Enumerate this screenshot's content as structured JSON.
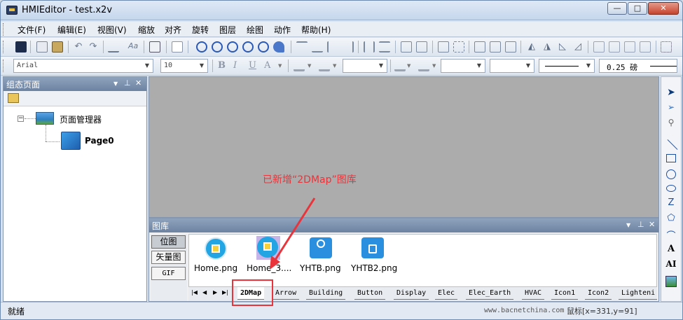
{
  "window": {
    "title": "HMIEditor - test.x2v"
  },
  "window_controls": {
    "minimize": "—",
    "maximize": "□",
    "close": "✕"
  },
  "menu": [
    "文件(F)",
    "编辑(E)",
    "视图(V)",
    "缩放",
    "对齐",
    "旋转",
    "图层",
    "绘图",
    "动作",
    "帮助(H)"
  ],
  "format_bar": {
    "font": "Arial",
    "size": "10",
    "line_width": "0.25 磅"
  },
  "left_panel": {
    "title": "组态页面",
    "root": "页面管理器",
    "page": "Page0"
  },
  "annotation": {
    "text": "已新增“2DMap”图库",
    "color": "#e8343a"
  },
  "gallery": {
    "title": "图库",
    "types": [
      "位图",
      "矢量图",
      "GIF"
    ],
    "items": [
      "Home.png",
      "Home_3....",
      "YHTB.png",
      "YHTB2.png"
    ],
    "tabs": [
      "2DMap",
      "Arrow",
      "Building",
      "Button",
      "Display",
      "Elec",
      "Elec_Earth",
      "HVAC",
      "Icon1",
      "Icon2",
      "Lighteni"
    ],
    "active_tab": "2DMap"
  },
  "status": {
    "left": "就绪",
    "url": "www.bacnetchina.com",
    "mouse": "鼠标[x=331,y=91]"
  }
}
